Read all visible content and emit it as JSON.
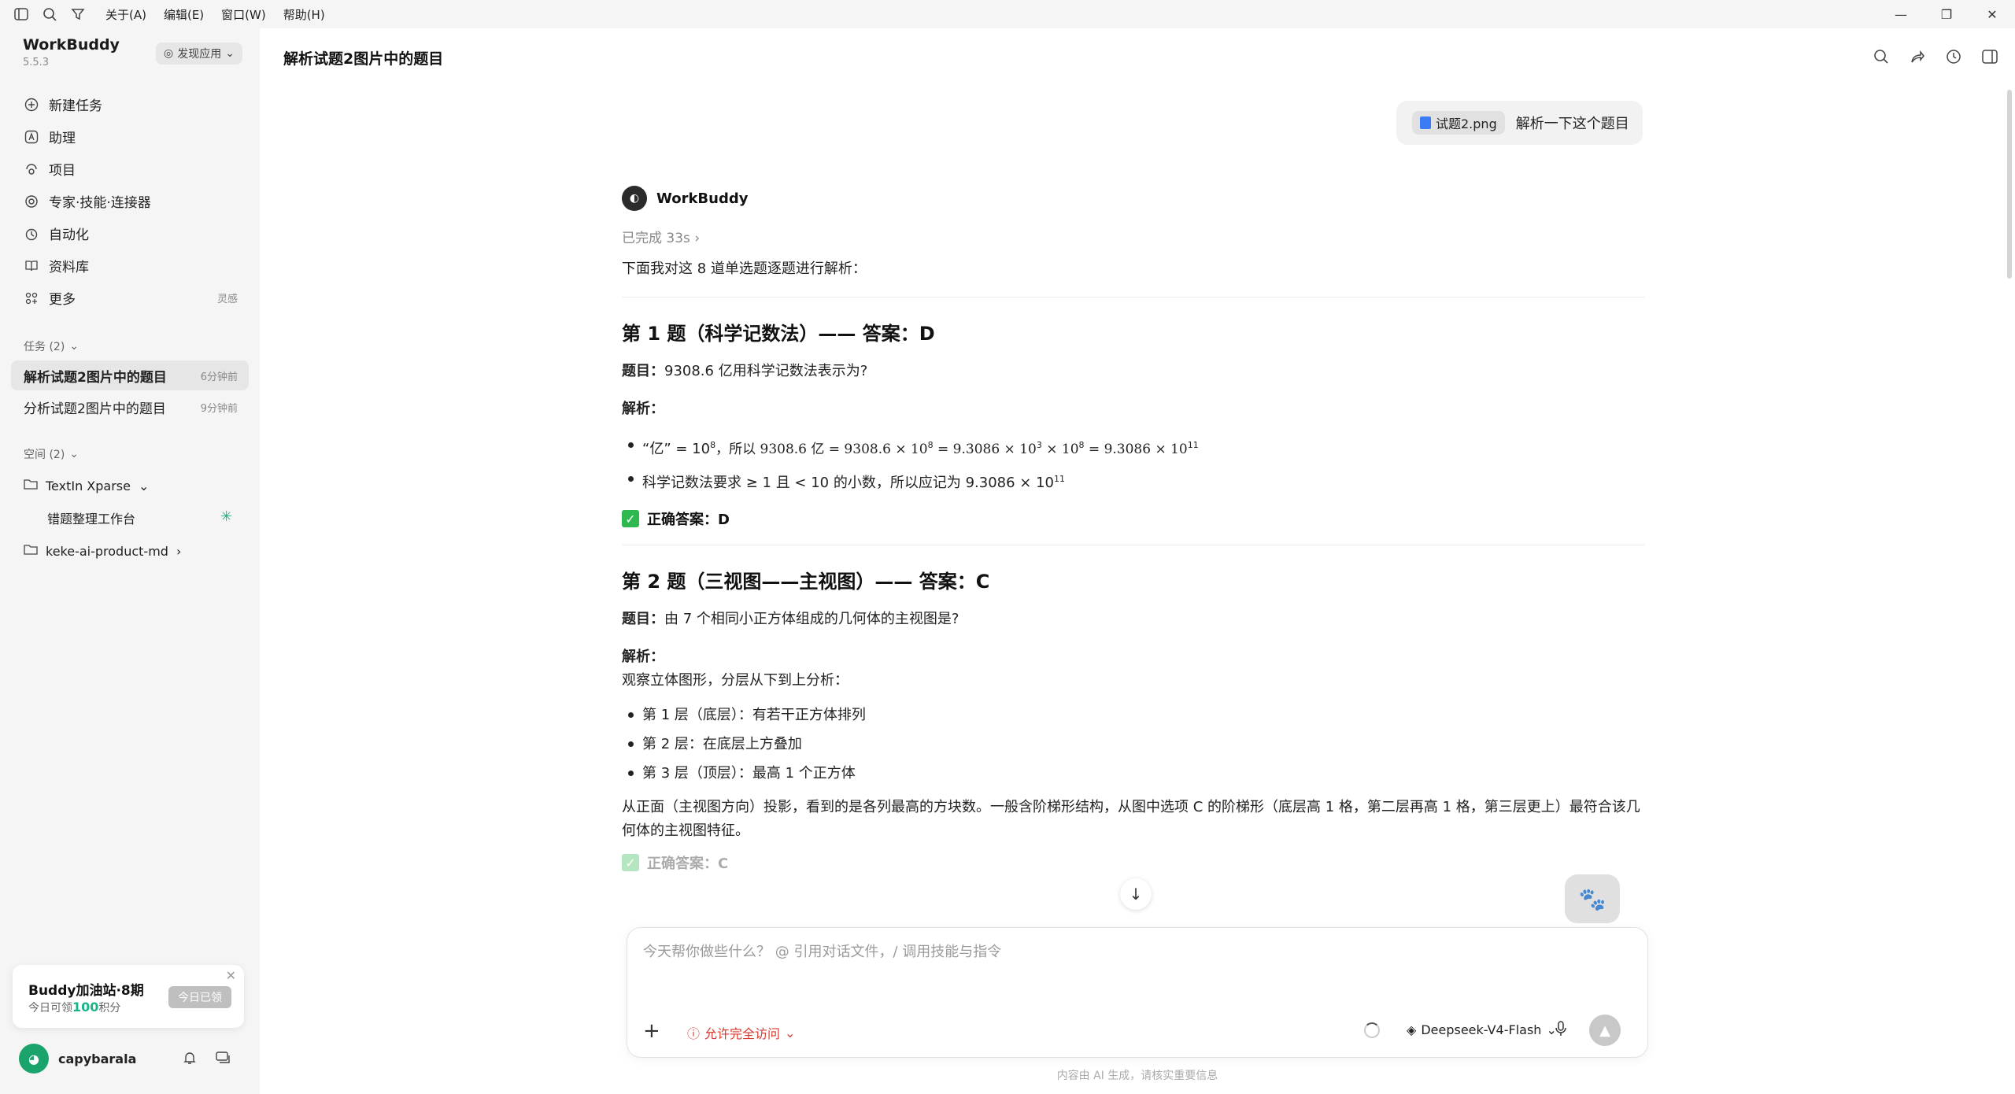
{
  "menu": [
    "关于(A)",
    "编辑(E)",
    "窗口(W)",
    "帮助(H)"
  ],
  "sidebar": {
    "app_name": "WorkBuddy",
    "version": "5.5.3",
    "discover_label": "发现应用",
    "nav": [
      {
        "label": "新建任务",
        "icon": "plus-circle-icon"
      },
      {
        "label": "助理",
        "icon": "assistant-icon"
      },
      {
        "label": "项目",
        "icon": "project-icon"
      },
      {
        "label": "专家·技能·连接器",
        "icon": "expert-icon"
      },
      {
        "label": "自动化",
        "icon": "clock-icon"
      },
      {
        "label": "资料库",
        "icon": "book-icon"
      },
      {
        "label": "更多",
        "icon": "grid-icon",
        "extra": "灵感"
      }
    ],
    "tasks_header": "任务 (2)",
    "tasks": [
      {
        "label": "解析试题2图片中的题目",
        "time": "6分钟前"
      },
      {
        "label": "分析试题2图片中的题目",
        "time": "9分钟前"
      }
    ],
    "spaces_header": "空间 (2)",
    "spaces": [
      {
        "label": "TextIn Xparse",
        "child": "错题整理工作台"
      },
      {
        "label": "keke-ai-product-md"
      }
    ],
    "promo": {
      "title": "Buddy加油站·8期",
      "sub_prefix": "今日可领",
      "sub_value": "100",
      "sub_suffix": "积分",
      "button": "今日已领"
    },
    "user": {
      "name": "capybarala"
    }
  },
  "main": {
    "title": "解析试题2图片中的题目",
    "user_message": {
      "attachment": "试题2.png",
      "text": "解析一下这个题目"
    },
    "bot": {
      "name": "WorkBuddy",
      "status": "已完成 33s",
      "intro": "下面我对这 8 道单选题逐题进行解析："
    },
    "q1": {
      "heading": "第 1 题（科学记数法）—— 答案：D",
      "question_label": "题目：",
      "question": "9308.6 亿用科学记数法表示为?",
      "analysis_label": "解析：",
      "bullet1_prefix": "“亿” = 10",
      "bullet1_text": "，所以 9308.6 亿 = 9308.6 × 10",
      "bullet1_mid": " = 9.3086 × 10",
      "bullet1_mid2": " × 10",
      "bullet1_end": " = 9.3086 × 10",
      "bullet1_sup_a": "8",
      "bullet1_sup_b": "8",
      "bullet1_sup_c": "3",
      "bullet1_sup_d": "8",
      "bullet1_sup_e": "11",
      "bullet2_text": "科学记数法要求 ≥ 1 且 < 10 的小数，所以应记为 9.3086 × 10",
      "bullet2_sup": "11",
      "answer": "正确答案：D"
    },
    "q2": {
      "heading": "第 2 题（三视图——主视图）—— 答案：C",
      "question_label": "题目：",
      "question": "由 7 个相同小正方体组成的几何体的主视图是?",
      "analysis_label": "解析：",
      "observe": "观察立体图形，分层从下到上分析：",
      "bullets": [
        "第 1 层（底层）：有若干正方体排列",
        "第 2 层：在底层上方叠加",
        "第 3 层（顶层）：最高 1 个正方体"
      ],
      "conclusion": "从正面（主视图方向）投影，看到的是各列最高的方块数。一般含阶梯形结构，从图中选项 C 的阶梯形（底层高 1 格，第二层再高 1 格，第三层更上）最符合该几何体的主视图特征。",
      "answer": "正确答案：C"
    },
    "composer": {
      "placeholder": "今天帮你做些什么？ @ 引用对话文件，/ 调用技能与指令",
      "access": "允许完全访问",
      "model": "Deepseek-V4-Flash"
    },
    "footer": "内容由 AI 生成，请核实重要信息"
  }
}
